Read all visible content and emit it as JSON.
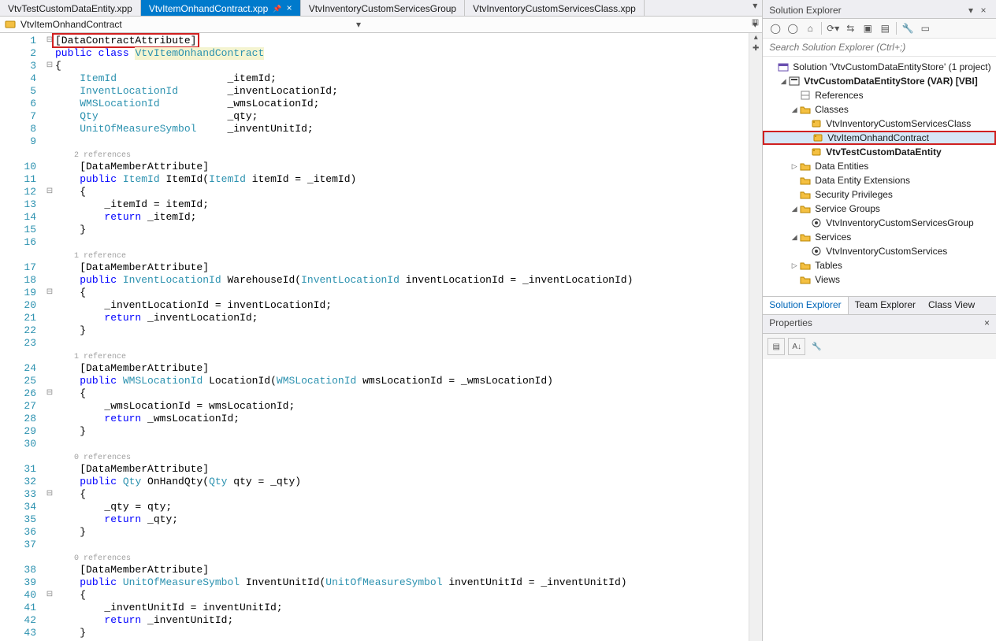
{
  "tabs": [
    {
      "label": "VtvTestCustomDataEntity.xpp",
      "active": false
    },
    {
      "label": "VtvItemOnhandContract.xpp",
      "active": true,
      "pinned": true
    },
    {
      "label": "VtvInventoryCustomServicesGroup",
      "active": false
    },
    {
      "label": "VtvInventoryCustomServicesClass.xpp",
      "active": false
    }
  ],
  "nav": {
    "current": "VtvItemOnhandContract"
  },
  "code_lines": [
    {
      "n": 1,
      "fold": "⊟",
      "spans": [
        {
          "t": "[DataContractAttribute]",
          "c": "txt",
          "box": true
        }
      ]
    },
    {
      "n": 2,
      "fold": "",
      "hl": true,
      "spans": [
        {
          "t": "public",
          "c": "kw"
        },
        {
          "t": " ",
          "c": "txt"
        },
        {
          "t": "class",
          "c": "kw"
        },
        {
          "t": " ",
          "c": "txt"
        },
        {
          "t": "VtvItemOnhandContract",
          "c": "type hl-line"
        }
      ]
    },
    {
      "n": 3,
      "fold": "⊟",
      "spans": [
        {
          "t": "{",
          "c": "txt"
        }
      ]
    },
    {
      "n": 4,
      "fold": "",
      "spans": [
        {
          "t": "    ",
          "c": "txt"
        },
        {
          "t": "ItemId",
          "c": "type"
        },
        {
          "t": "                  _itemId;",
          "c": "txt"
        }
      ]
    },
    {
      "n": 5,
      "fold": "",
      "spans": [
        {
          "t": "    ",
          "c": "txt"
        },
        {
          "t": "InventLocationId",
          "c": "type"
        },
        {
          "t": "        _inventLocationId;",
          "c": "txt"
        }
      ]
    },
    {
      "n": 6,
      "fold": "",
      "spans": [
        {
          "t": "    ",
          "c": "txt"
        },
        {
          "t": "WMSLocationId",
          "c": "type"
        },
        {
          "t": "           _wmsLocationId;",
          "c": "txt"
        }
      ]
    },
    {
      "n": 7,
      "fold": "",
      "spans": [
        {
          "t": "    ",
          "c": "txt"
        },
        {
          "t": "Qty",
          "c": "type"
        },
        {
          "t": "                     _qty;",
          "c": "txt"
        }
      ]
    },
    {
      "n": 8,
      "fold": "",
      "spans": [
        {
          "t": "    ",
          "c": "txt"
        },
        {
          "t": "UnitOfMeasureSymbol",
          "c": "type"
        },
        {
          "t": "     _inventUnitId;",
          "c": "txt"
        }
      ]
    },
    {
      "n": 9,
      "fold": "",
      "spans": [
        {
          "t": "",
          "c": "txt"
        }
      ]
    },
    {
      "n": null,
      "fold": "",
      "spans": [
        {
          "t": "    2 references",
          "c": "refnote"
        }
      ]
    },
    {
      "n": 10,
      "fold": "",
      "spans": [
        {
          "t": "    [DataMemberAttribute]",
          "c": "txt"
        }
      ]
    },
    {
      "n": 11,
      "fold": "",
      "spans": [
        {
          "t": "    ",
          "c": "txt"
        },
        {
          "t": "public",
          "c": "kw"
        },
        {
          "t": " ",
          "c": "txt"
        },
        {
          "t": "ItemId",
          "c": "type"
        },
        {
          "t": " ItemId(",
          "c": "txt"
        },
        {
          "t": "ItemId",
          "c": "type"
        },
        {
          "t": " itemId = _itemId)",
          "c": "txt"
        }
      ]
    },
    {
      "n": 12,
      "fold": "⊟",
      "spans": [
        {
          "t": "    {",
          "c": "txt"
        }
      ]
    },
    {
      "n": 13,
      "fold": "",
      "spans": [
        {
          "t": "        _itemId = itemId;",
          "c": "txt"
        }
      ]
    },
    {
      "n": 14,
      "fold": "",
      "spans": [
        {
          "t": "        ",
          "c": "txt"
        },
        {
          "t": "return",
          "c": "kw"
        },
        {
          "t": " _itemId;",
          "c": "txt"
        }
      ]
    },
    {
      "n": 15,
      "fold": "",
      "spans": [
        {
          "t": "    }",
          "c": "txt"
        }
      ]
    },
    {
      "n": 16,
      "fold": "",
      "spans": [
        {
          "t": "",
          "c": "txt"
        }
      ]
    },
    {
      "n": null,
      "fold": "",
      "spans": [
        {
          "t": "    1 reference",
          "c": "refnote"
        }
      ]
    },
    {
      "n": 17,
      "fold": "",
      "spans": [
        {
          "t": "    [DataMemberAttribute]",
          "c": "txt"
        }
      ]
    },
    {
      "n": 18,
      "fold": "",
      "spans": [
        {
          "t": "    ",
          "c": "txt"
        },
        {
          "t": "public",
          "c": "kw"
        },
        {
          "t": " ",
          "c": "txt"
        },
        {
          "t": "InventLocationId",
          "c": "type"
        },
        {
          "t": " WarehouseId(",
          "c": "txt"
        },
        {
          "t": "InventLocationId",
          "c": "type"
        },
        {
          "t": " inventLocationId = _inventLocationId)",
          "c": "txt"
        }
      ]
    },
    {
      "n": 19,
      "fold": "⊟",
      "spans": [
        {
          "t": "    {",
          "c": "txt"
        }
      ]
    },
    {
      "n": 20,
      "fold": "",
      "spans": [
        {
          "t": "        _inventLocationId = inventLocationId;",
          "c": "txt"
        }
      ]
    },
    {
      "n": 21,
      "fold": "",
      "spans": [
        {
          "t": "        ",
          "c": "txt"
        },
        {
          "t": "return",
          "c": "kw"
        },
        {
          "t": " _inventLocationId;",
          "c": "txt"
        }
      ]
    },
    {
      "n": 22,
      "fold": "",
      "spans": [
        {
          "t": "    }",
          "c": "txt"
        }
      ]
    },
    {
      "n": 23,
      "fold": "",
      "spans": [
        {
          "t": "",
          "c": "txt"
        }
      ]
    },
    {
      "n": null,
      "fold": "",
      "spans": [
        {
          "t": "    1 reference",
          "c": "refnote"
        }
      ]
    },
    {
      "n": 24,
      "fold": "",
      "spans": [
        {
          "t": "    [DataMemberAttribute]",
          "c": "txt"
        }
      ]
    },
    {
      "n": 25,
      "fold": "",
      "spans": [
        {
          "t": "    ",
          "c": "txt"
        },
        {
          "t": "public",
          "c": "kw"
        },
        {
          "t": " ",
          "c": "txt"
        },
        {
          "t": "WMSLocationId",
          "c": "type"
        },
        {
          "t": " LocationId(",
          "c": "txt"
        },
        {
          "t": "WMSLocationId",
          "c": "type"
        },
        {
          "t": " wmsLocationId = _wmsLocationId)",
          "c": "txt"
        }
      ]
    },
    {
      "n": 26,
      "fold": "⊟",
      "spans": [
        {
          "t": "    {",
          "c": "txt"
        }
      ]
    },
    {
      "n": 27,
      "fold": "",
      "spans": [
        {
          "t": "        _wmsLocationId = wmsLocationId;",
          "c": "txt"
        }
      ]
    },
    {
      "n": 28,
      "fold": "",
      "spans": [
        {
          "t": "        ",
          "c": "txt"
        },
        {
          "t": "return",
          "c": "kw"
        },
        {
          "t": " _wmsLocationId;",
          "c": "txt"
        }
      ]
    },
    {
      "n": 29,
      "fold": "",
      "spans": [
        {
          "t": "    }",
          "c": "txt"
        }
      ]
    },
    {
      "n": 30,
      "fold": "",
      "spans": [
        {
          "t": "",
          "c": "txt"
        }
      ]
    },
    {
      "n": null,
      "fold": "",
      "spans": [
        {
          "t": "    0 references",
          "c": "refnote"
        }
      ]
    },
    {
      "n": 31,
      "fold": "",
      "spans": [
        {
          "t": "    [DataMemberAttribute]",
          "c": "txt"
        }
      ]
    },
    {
      "n": 32,
      "fold": "",
      "spans": [
        {
          "t": "    ",
          "c": "txt"
        },
        {
          "t": "public",
          "c": "kw"
        },
        {
          "t": " ",
          "c": "txt"
        },
        {
          "t": "Qty",
          "c": "type"
        },
        {
          "t": " OnHandQty(",
          "c": "txt"
        },
        {
          "t": "Qty",
          "c": "type"
        },
        {
          "t": " qty = _qty)",
          "c": "txt"
        }
      ]
    },
    {
      "n": 33,
      "fold": "⊟",
      "spans": [
        {
          "t": "    {",
          "c": "txt"
        }
      ]
    },
    {
      "n": 34,
      "fold": "",
      "spans": [
        {
          "t": "        _qty = qty;",
          "c": "txt"
        }
      ]
    },
    {
      "n": 35,
      "fold": "",
      "spans": [
        {
          "t": "        ",
          "c": "txt"
        },
        {
          "t": "return",
          "c": "kw"
        },
        {
          "t": " _qty;",
          "c": "txt"
        }
      ]
    },
    {
      "n": 36,
      "fold": "",
      "spans": [
        {
          "t": "    }",
          "c": "txt"
        }
      ]
    },
    {
      "n": 37,
      "fold": "",
      "spans": [
        {
          "t": "",
          "c": "txt"
        }
      ]
    },
    {
      "n": null,
      "fold": "",
      "spans": [
        {
          "t": "    0 references",
          "c": "refnote"
        }
      ]
    },
    {
      "n": 38,
      "fold": "",
      "spans": [
        {
          "t": "    [DataMemberAttribute]",
          "c": "txt"
        }
      ]
    },
    {
      "n": 39,
      "fold": "",
      "spans": [
        {
          "t": "    ",
          "c": "txt"
        },
        {
          "t": "public",
          "c": "kw"
        },
        {
          "t": " ",
          "c": "txt"
        },
        {
          "t": "UnitOfMeasureSymbol",
          "c": "type"
        },
        {
          "t": " InventUnitId(",
          "c": "txt"
        },
        {
          "t": "UnitOfMeasureSymbol",
          "c": "type"
        },
        {
          "t": " inventUnitId = _inventUnitId)",
          "c": "txt"
        }
      ]
    },
    {
      "n": 40,
      "fold": "⊟",
      "spans": [
        {
          "t": "    {",
          "c": "txt"
        }
      ]
    },
    {
      "n": 41,
      "fold": "",
      "spans": [
        {
          "t": "        _inventUnitId = inventUnitId;",
          "c": "txt"
        }
      ]
    },
    {
      "n": 42,
      "fold": "",
      "spans": [
        {
          "t": "        ",
          "c": "txt"
        },
        {
          "t": "return",
          "c": "kw"
        },
        {
          "t": " _inventUnitId;",
          "c": "txt"
        }
      ]
    },
    {
      "n": 43,
      "fold": "",
      "spans": [
        {
          "t": "    }",
          "c": "txt"
        }
      ]
    }
  ],
  "solution_explorer": {
    "title": "Solution Explorer",
    "search_placeholder": "Search Solution Explorer (Ctrl+;)",
    "tree": [
      {
        "d": 1,
        "exp": "",
        "ic": "sln",
        "label": "Solution 'VtvCustomDataEntityStore' (1 project)"
      },
      {
        "d": 2,
        "exp": "▢",
        "ic": "proj",
        "label": "VtvCustomDataEntityStore (VAR) [VBI]",
        "bold": true
      },
      {
        "d": 3,
        "exp": "",
        "ic": "ref",
        "label": "References"
      },
      {
        "d": 3,
        "exp": "▢",
        "ic": "folder",
        "label": "Classes"
      },
      {
        "d": 4,
        "exp": "",
        "ic": "class",
        "label": "VtvInventoryCustomServicesClass"
      },
      {
        "d": 4,
        "exp": "",
        "ic": "class",
        "label": "VtvItemOnhandContract",
        "selected": true
      },
      {
        "d": 4,
        "exp": "",
        "ic": "class",
        "label": "VtvTestCustomDataEntity",
        "bold": true
      },
      {
        "d": 3,
        "exp": "▷",
        "ic": "folder",
        "label": "Data Entities"
      },
      {
        "d": 3,
        "exp": "",
        "ic": "folder",
        "label": "Data Entity Extensions"
      },
      {
        "d": 3,
        "exp": "",
        "ic": "folder",
        "label": "Security Privileges"
      },
      {
        "d": 3,
        "exp": "▢",
        "ic": "folder",
        "label": "Service Groups"
      },
      {
        "d": 4,
        "exp": "",
        "ic": "svc",
        "label": "VtvInventoryCustomServicesGroup"
      },
      {
        "d": 3,
        "exp": "▢",
        "ic": "folder",
        "label": "Services"
      },
      {
        "d": 4,
        "exp": "",
        "ic": "svc",
        "label": "VtvInventoryCustomServices"
      },
      {
        "d": 3,
        "exp": "▷",
        "ic": "folder",
        "label": "Tables"
      },
      {
        "d": 3,
        "exp": "",
        "ic": "folder",
        "label": "Views"
      }
    ],
    "bottom_tabs": [
      "Solution Explorer",
      "Team Explorer",
      "Class View"
    ]
  },
  "properties": {
    "title": "Properties"
  }
}
